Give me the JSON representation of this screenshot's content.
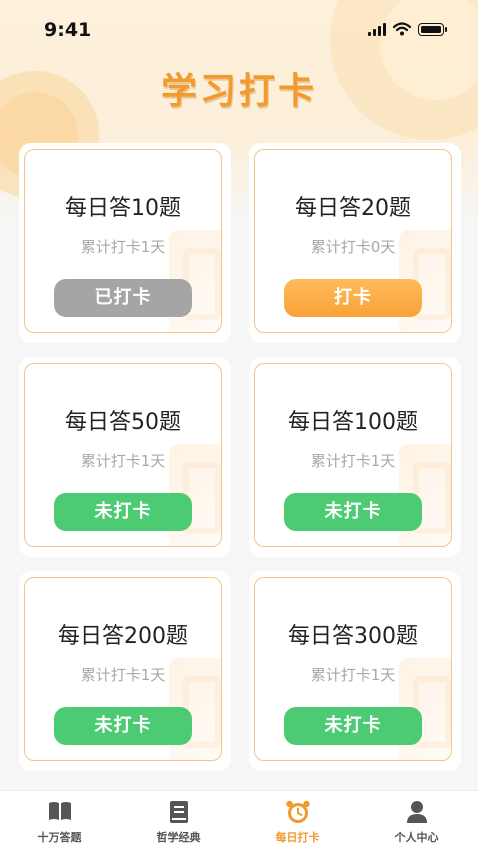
{
  "status_bar": {
    "time": "9:41"
  },
  "page_title": "学习打卡",
  "cards": [
    {
      "title": "每日答10题",
      "streak": "累计打卡1天",
      "button": "已打卡",
      "state": "done"
    },
    {
      "title": "每日答20题",
      "streak": "累计打卡0天",
      "button": "打卡",
      "state": "available"
    },
    {
      "title": "每日答50题",
      "streak": "累计打卡1天",
      "button": "未打卡",
      "state": "pending"
    },
    {
      "title": "每日答100题",
      "streak": "累计打卡1天",
      "button": "未打卡",
      "state": "pending"
    },
    {
      "title": "每日答200题",
      "streak": "累计打卡1天",
      "button": "未打卡",
      "state": "pending"
    },
    {
      "title": "每日答300题",
      "streak": "累计打卡1天",
      "button": "未打卡",
      "state": "pending"
    }
  ],
  "tabbar": {
    "items": [
      {
        "label": "十万答题",
        "icon": "open-book-icon",
        "active": false
      },
      {
        "label": "哲学经典",
        "icon": "book-icon",
        "active": false
      },
      {
        "label": "每日打卡",
        "icon": "alarm-clock-icon",
        "active": true
      },
      {
        "label": "个人中心",
        "icon": "person-icon",
        "active": false
      }
    ]
  },
  "colors": {
    "accent": "#f19b2e",
    "done_button": "#a5a5a5",
    "checkin_button": "#f9a238",
    "pending_button": "#4ccb72",
    "card_border": "#f3c58d"
  }
}
